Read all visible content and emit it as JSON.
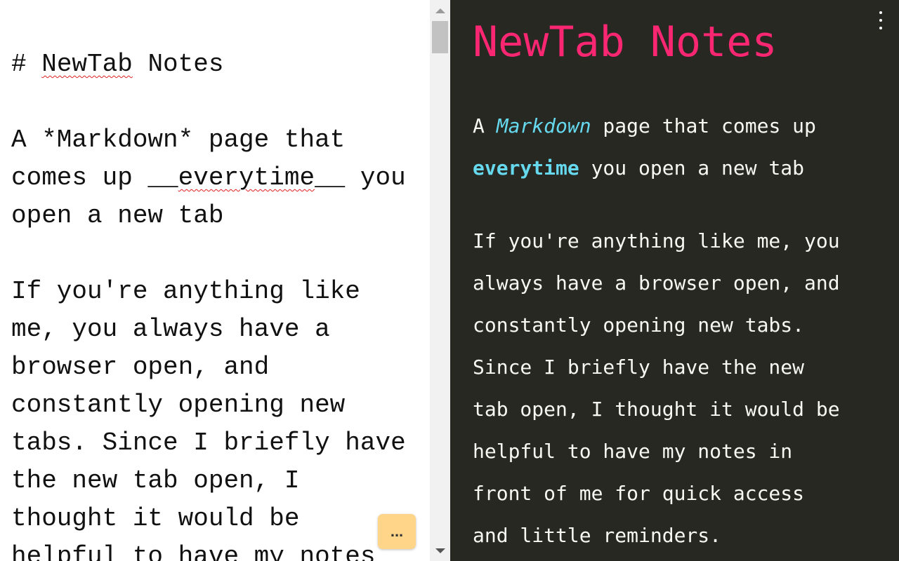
{
  "editor": {
    "lines": [
      [
        {
          "t": "# "
        },
        {
          "t": "NewTab",
          "spell": true
        },
        {
          "t": " Notes"
        }
      ],
      [],
      [
        {
          "t": "A *Markdown* page that"
        }
      ],
      [
        {
          "t": "comes up __"
        },
        {
          "t": "everytime",
          "spell": true
        },
        {
          "t": "__ you"
        }
      ],
      [
        {
          "t": "open a new tab"
        }
      ],
      [],
      [
        {
          "t": "If you're anything like"
        }
      ],
      [
        {
          "t": "me, you always have a"
        }
      ],
      [
        {
          "t": "browser open, and"
        }
      ],
      [
        {
          "t": "constantly opening new"
        }
      ],
      [
        {
          "t": "tabs. Since I briefly have"
        }
      ],
      [
        {
          "t": "the new tab open, I"
        }
      ],
      [
        {
          "t": "thought it would be"
        }
      ],
      [
        {
          "t": "helpful to have my notes"
        }
      ]
    ]
  },
  "more_button": {
    "label": "..."
  },
  "preview": {
    "title": "NewTab Notes",
    "paragraphs": [
      [
        [
          {
            "t": "A "
          },
          {
            "t": "Markdown",
            "em": true
          },
          {
            "t": " page that comes up"
          }
        ],
        [
          {
            "t": "everytime",
            "strong": true
          },
          {
            "t": " you open a new tab"
          }
        ]
      ],
      [
        [
          {
            "t": "If you're anything like me, you"
          }
        ],
        [
          {
            "t": "always have a browser open, and"
          }
        ],
        [
          {
            "t": "constantly opening new tabs."
          }
        ],
        [
          {
            "t": "Since I briefly have the new"
          }
        ],
        [
          {
            "t": "tab open, I thought it would be"
          }
        ],
        [
          {
            "t": "helpful to have my notes in"
          }
        ],
        [
          {
            "t": "front of me for quick access"
          }
        ],
        [
          {
            "t": "and little reminders."
          }
        ]
      ]
    ],
    "menu_icon": "kebab-menu-icon"
  },
  "colors": {
    "preview_bg": "#272822",
    "heading": "#f92672",
    "emphasis": "#66d9ef",
    "text": "#f8f8f2",
    "button_bg": "#ffd58a"
  }
}
